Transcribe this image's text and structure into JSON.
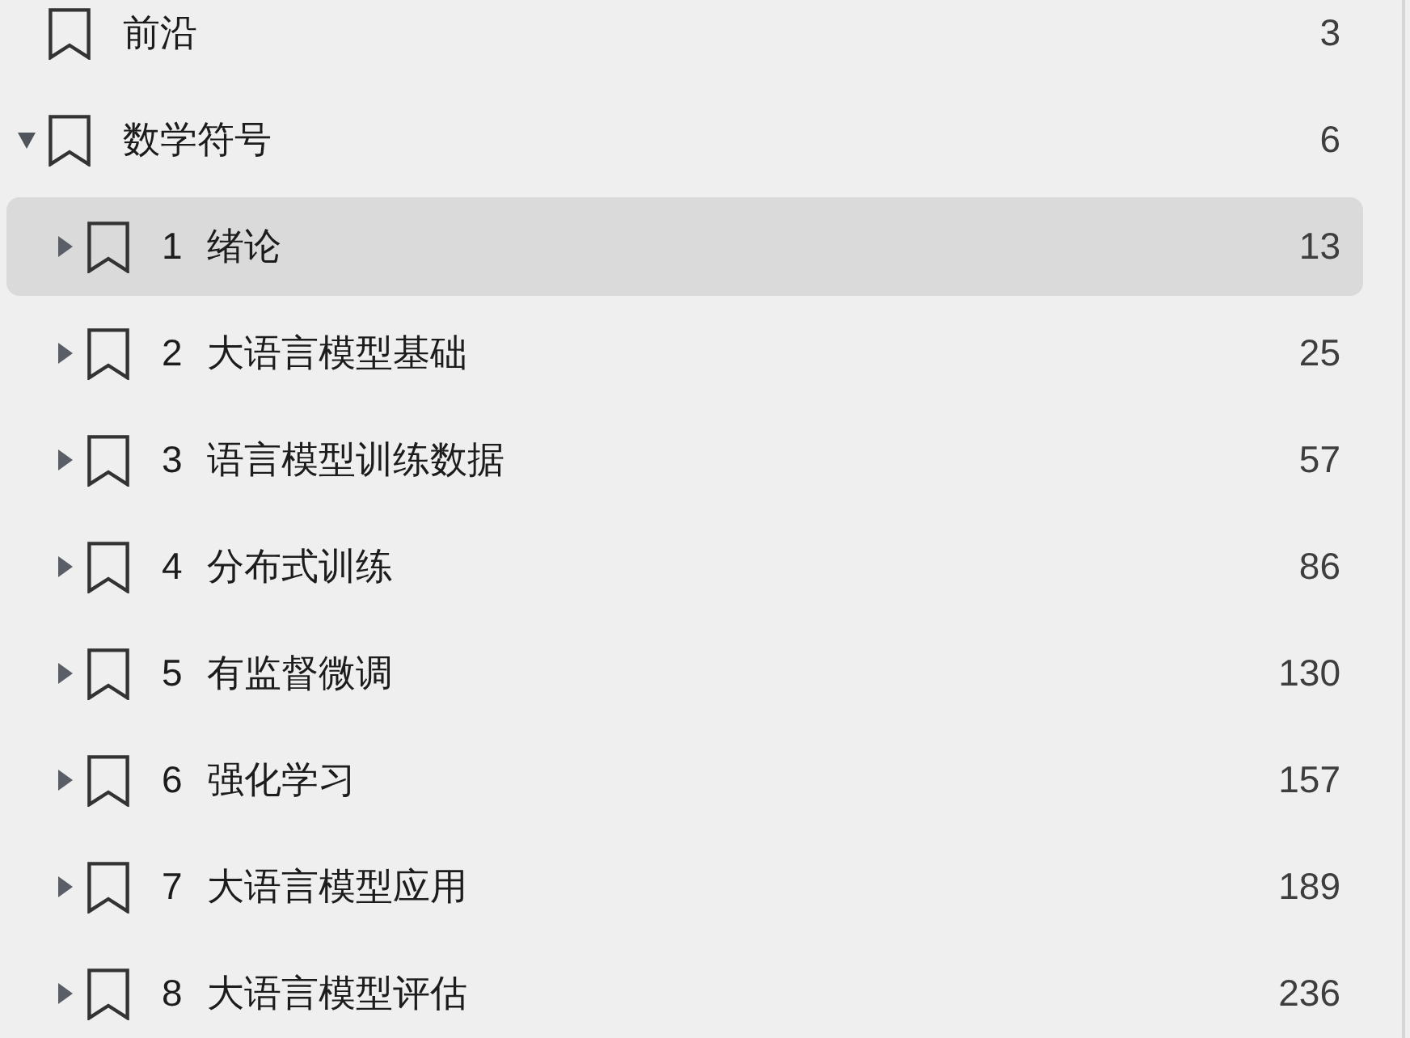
{
  "outline": {
    "items": [
      {
        "title": "前沿",
        "page": "3",
        "selected": false
      },
      {
        "title": "数学符号",
        "page": "6",
        "selected": false,
        "expanded": true,
        "children": [
          {
            "number": "1",
            "title": "绪论",
            "page": "13",
            "selected": true,
            "expanded": false
          },
          {
            "number": "2",
            "title": "大语言模型基础",
            "page": "25",
            "selected": false,
            "expanded": false
          },
          {
            "number": "3",
            "title": "语言模型训练数据",
            "page": "57",
            "selected": false,
            "expanded": false
          },
          {
            "number": "4",
            "title": "分布式训练",
            "page": "86",
            "selected": false,
            "expanded": false
          },
          {
            "number": "5",
            "title": "有监督微调",
            "page": "130",
            "selected": false,
            "expanded": false
          },
          {
            "number": "6",
            "title": "强化学习",
            "page": "157",
            "selected": false,
            "expanded": false
          },
          {
            "number": "7",
            "title": "大语言模型应用",
            "page": "189",
            "selected": false,
            "expanded": false
          },
          {
            "number": "8",
            "title": "大语言模型评估",
            "page": "236",
            "selected": false,
            "expanded": false
          }
        ]
      }
    ]
  }
}
